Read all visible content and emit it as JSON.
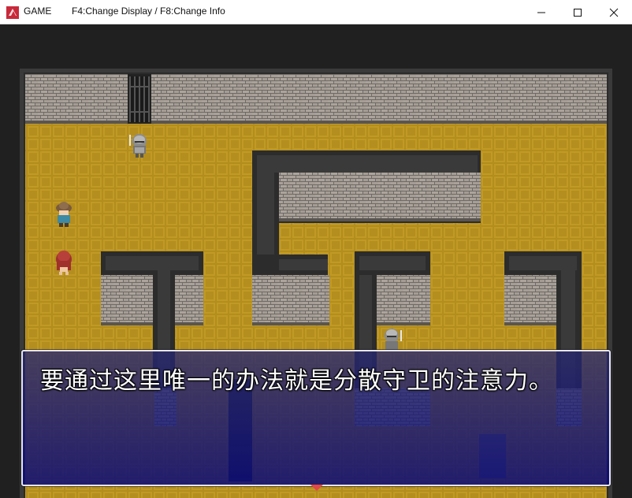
{
  "window": {
    "app_title": "GAME",
    "info_text": "F4:Change Display / F8:Change Info",
    "icons": [
      "app-icon",
      "minimize-icon",
      "maximize-icon",
      "close-icon"
    ]
  },
  "message": {
    "text": "要通过这里唯一的办法就是分散守卫的注意力。"
  },
  "scene": {
    "characters": [
      "guard-top",
      "villager-brown-hat",
      "red-haired-heroine",
      "guard-bottom"
    ],
    "colors": {
      "floor": "#b89220",
      "wall_top": "#2e2e2e",
      "brick": "#a8a098"
    }
  }
}
